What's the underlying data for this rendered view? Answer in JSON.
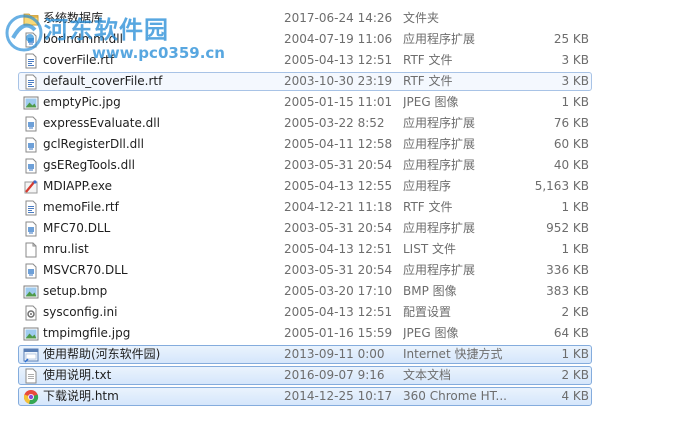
{
  "watermark": {
    "title": "河东软件园",
    "url": "www.pc0359.cn"
  },
  "colors": {
    "selection_border": "#84acdd",
    "selection_fill": "#dce9fb",
    "watermark": "#2a8fd8",
    "secondary_text": "#6d6d6d"
  },
  "files": [
    {
      "name": "系统数据库",
      "date": "2017-06-24",
      "time": "14:26",
      "type": "文件夹",
      "size": "",
      "icon": "folder-icon",
      "state": ""
    },
    {
      "name": "borlndmm.dll",
      "date": "2004-07-19",
      "time": "11:06",
      "type": "应用程序扩展",
      "size": "25 KB",
      "icon": "dll-icon",
      "state": ""
    },
    {
      "name": "coverFile.rtf",
      "date": "2005-04-13",
      "time": "12:51",
      "type": "RTF 文件",
      "size": "3 KB",
      "icon": "rtf-icon",
      "state": ""
    },
    {
      "name": "default_coverFile.rtf",
      "date": "2003-10-30",
      "time": "23:19",
      "type": "RTF 文件",
      "size": "3 KB",
      "icon": "rtf-icon",
      "state": "outlined"
    },
    {
      "name": "emptyPic.jpg",
      "date": "2005-01-15",
      "time": "11:01",
      "type": "JPEG 图像",
      "size": "1 KB",
      "icon": "image-icon",
      "state": ""
    },
    {
      "name": "expressEvaluate.dll",
      "date": "2005-03-22",
      "time": "8:52",
      "type": "应用程序扩展",
      "size": "76 KB",
      "icon": "dll-icon",
      "state": ""
    },
    {
      "name": "gclRegisterDll.dll",
      "date": "2005-04-11",
      "time": "12:58",
      "type": "应用程序扩展",
      "size": "60 KB",
      "icon": "dll-icon",
      "state": ""
    },
    {
      "name": "gsERegTools.dll",
      "date": "2003-05-31",
      "time": "20:54",
      "type": "应用程序扩展",
      "size": "40 KB",
      "icon": "dll-icon",
      "state": ""
    },
    {
      "name": "MDIAPP.exe",
      "date": "2005-04-13",
      "time": "12:55",
      "type": "应用程序",
      "size": "5,163 KB",
      "icon": "exe-icon",
      "state": ""
    },
    {
      "name": "memoFile.rtf",
      "date": "2004-12-21",
      "time": "11:18",
      "type": "RTF 文件",
      "size": "1 KB",
      "icon": "rtf-icon",
      "state": ""
    },
    {
      "name": "MFC70.DLL",
      "date": "2003-05-31",
      "time": "20:54",
      "type": "应用程序扩展",
      "size": "952 KB",
      "icon": "dll-icon",
      "state": ""
    },
    {
      "name": "mru.list",
      "date": "2005-04-13",
      "time": "12:51",
      "type": "LIST 文件",
      "size": "1 KB",
      "icon": "file-icon",
      "state": ""
    },
    {
      "name": "MSVCR70.DLL",
      "date": "2003-05-31",
      "time": "20:54",
      "type": "应用程序扩展",
      "size": "336 KB",
      "icon": "dll-icon",
      "state": ""
    },
    {
      "name": "setup.bmp",
      "date": "2005-03-20",
      "time": "17:10",
      "type": "BMP 图像",
      "size": "383 KB",
      "icon": "image-icon",
      "state": ""
    },
    {
      "name": "sysconfig.ini",
      "date": "2005-04-13",
      "time": "12:51",
      "type": "配置设置",
      "size": "2 KB",
      "icon": "ini-icon",
      "state": ""
    },
    {
      "name": "tmpimgfile.jpg",
      "date": "2005-01-16",
      "time": "15:59",
      "type": "JPEG 图像",
      "size": "64 KB",
      "icon": "image-icon",
      "state": ""
    },
    {
      "name": "使用帮助(河东软件园)",
      "date": "2013-09-11",
      "time": "0:00",
      "type": "Internet 快捷方式",
      "size": "1 KB",
      "icon": "internet-shortcut-icon",
      "state": "selected"
    },
    {
      "name": "使用说明.txt",
      "date": "2016-09-07",
      "time": "9:16",
      "type": "文本文档",
      "size": "2 KB",
      "icon": "text-file-icon",
      "state": "selected"
    },
    {
      "name": "下载说明.htm",
      "date": "2014-12-25",
      "time": "10:17",
      "type": "360 Chrome HT...",
      "size": "4 KB",
      "icon": "chrome-html-icon",
      "state": "selected"
    }
  ]
}
